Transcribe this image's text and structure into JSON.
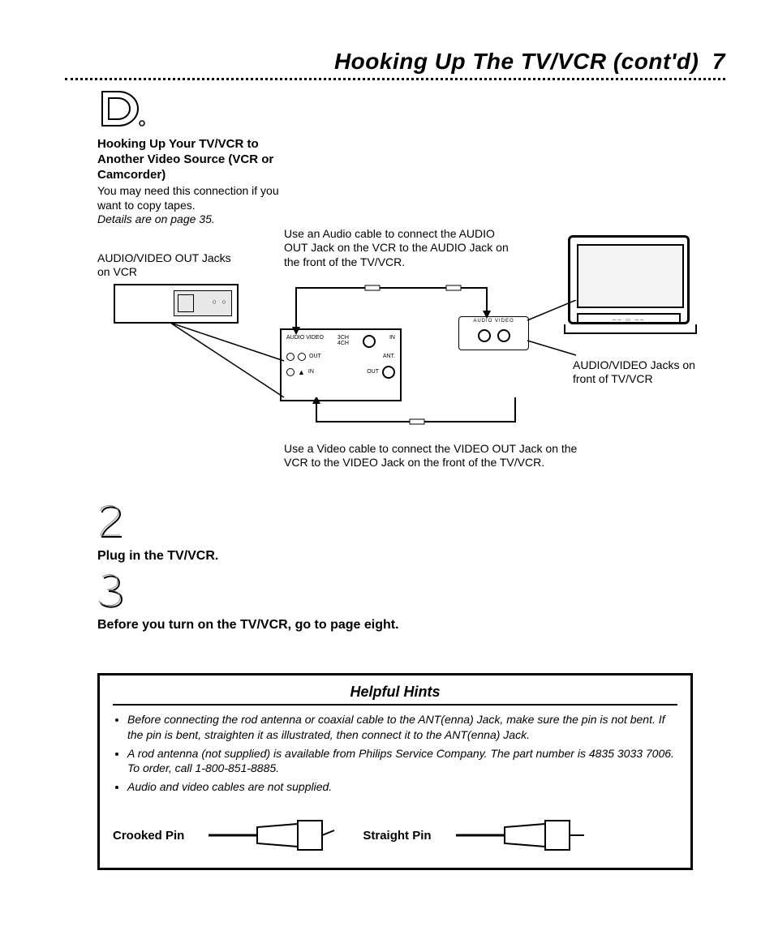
{
  "header": {
    "title": "Hooking Up The TV/VCR (cont'd)",
    "page_number": "7"
  },
  "sectionD": {
    "letter": "D",
    "heading": "Hooking Up Your TV/VCR to Another Video Source (VCR or Camcorder)",
    "body": "You may need this connection if you want to copy tapes.",
    "detail": "Details are on page 35."
  },
  "diagram": {
    "label_vcr_out": "AUDIO/VIDEO OUT Jacks on VCR",
    "label_audio_cable": "Use an Audio cable to connect the AUDIO OUT Jack on the VCR to the AUDIO Jack on the front of the TV/VCR.",
    "label_front_jacks": "AUDIO/VIDEO Jacks on front of TV/VCR",
    "label_video_cable": "Use a Video cable to connect the VIDEO OUT Jack on the VCR to the VIDEO Jack on the front of the TV/VCR.",
    "panel": {
      "av_label": "AUDIO VIDEO",
      "out_label": "OUT",
      "in_label": "IN",
      "ch_label": "3CH\n4CH",
      "ant_label": "ANT.",
      "out2_label": "OUT"
    }
  },
  "step2": {
    "number": "2",
    "text": "Plug in the TV/VCR."
  },
  "step3": {
    "number": "3",
    "text": "Before you turn on the TV/VCR, go to page eight."
  },
  "hints": {
    "title": "Helpful Hints",
    "items": [
      "Before connecting the rod antenna or coaxial cable to the ANT(enna) Jack, make sure the pin is not bent. If the pin is bent, straighten it as illustrated, then connect it to the ANT(enna) Jack.",
      "A rod antenna (not supplied) is available from Philips Service Company. The part number is 4835 3033 7006. To order, call 1-800-851-8885.",
      "Audio and video cables are not supplied."
    ],
    "crooked_label": "Crooked Pin",
    "straight_label": "Straight Pin"
  }
}
